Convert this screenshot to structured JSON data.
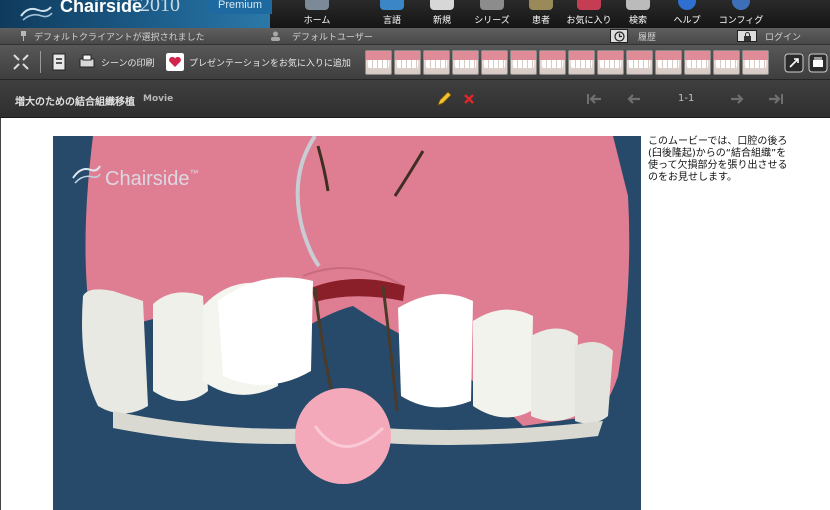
{
  "app": {
    "brand_name": "Chairside",
    "brand_tm": "™",
    "year": "2010",
    "edition": "Premium"
  },
  "nav": {
    "items": [
      {
        "label": "ホーム",
        "icon": "home-icon"
      },
      {
        "label": "言語",
        "icon": "language-icon"
      },
      {
        "label": "新規",
        "icon": "new-icon"
      },
      {
        "label": "シリーズ",
        "icon": "series-icon"
      },
      {
        "label": "患者",
        "icon": "patient-icon"
      },
      {
        "label": "お気に入り",
        "icon": "favorites-icon"
      },
      {
        "label": "検索",
        "icon": "search-icon"
      },
      {
        "label": "ヘルプ",
        "icon": "help-icon"
      },
      {
        "label": "コンフィグ",
        "icon": "config-icon"
      }
    ]
  },
  "status": {
    "client": "デフォルトクライアントが選択されました",
    "user": "デフォルトユーザー",
    "history": "履歴",
    "login": "ログイン"
  },
  "toolbar": {
    "print_label": "シーンの印刷",
    "favorite_label": "プレゼンテーションをお気に入りに追加"
  },
  "scene": {
    "title": "増大のための結合組織移植",
    "type": "Movie",
    "page": "1-1"
  },
  "movie": {
    "watermark": "Chairside",
    "watermark_tm": "™"
  },
  "description": "このムービーでは、口腔の後ろ(臼後隆起)からの“結合組織”を使って欠損部分を張り出させるのをお見せします。",
  "colors": {
    "movie_background": "#274a6a",
    "gum": "#e07f93",
    "tooth": "#f2f2ee",
    "brand_blue": "#1d5f8d"
  }
}
